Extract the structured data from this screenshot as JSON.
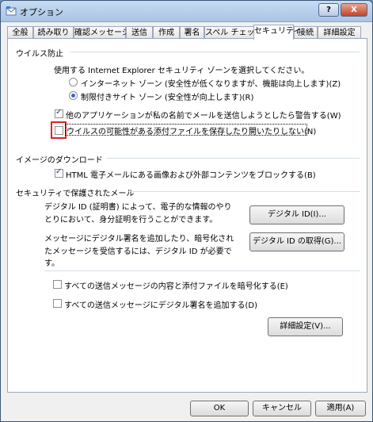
{
  "window": {
    "title": "オプション",
    "help_label": "?",
    "close_label": "X"
  },
  "tabs": [
    "全般",
    "読み取り",
    "確認メッセージ",
    "送信",
    "作成",
    "署名",
    "スペル チェック",
    "セキュリティ",
    "接続",
    "詳細設定"
  ],
  "virus": {
    "heading": "ウイルス防止",
    "zone_prompt": "使用する Internet Explorer セキュリティ ゾーンを選択してください。",
    "radio_internet": "インターネット ゾーン (安全性が低くなりますが、機能は向上します)(Z)",
    "radio_restricted": "制限付きサイト ゾーン (安全性が向上します)(R)",
    "radio_selected": "restricted",
    "warn_label": "他のアプリケーションが私の名前でメールを送信しようとしたら警告する(W)",
    "warn_checked": true,
    "attach_label": "ウイルスの可能性がある添付ファイルを保存したり開いたりしない(N)",
    "attach_checked": false
  },
  "images": {
    "heading": "イメージのダウンロード",
    "block_label": "HTML 電子メールにある画像および外部コンテンツをブロックする(B)",
    "block_checked": true
  },
  "secure_mail": {
    "heading": "セキュリティで保護されたメール",
    "digital_id_text1": "デジタル ID (証明書) によって、電子的な情報のやり",
    "digital_id_text2": "とりにおいて、身分証明を行うことができます。",
    "digital_id_button": "デジタル ID(I)...",
    "sign_text1": "メッセージにデジタル署名を追加したり、暗号化され",
    "sign_text2": "たメッセージを受信するには、デジタル ID が必要で",
    "sign_text3": "す。",
    "get_id_button": "デジタル ID の取得(G)...",
    "encrypt_label": "すべての送信メッセージの内容と添付ファイルを暗号化する(E)",
    "encrypt_checked": false,
    "sign_label": "すべての送信メッセージにデジタル署名を追加する(D)",
    "sign_checked": false,
    "advanced_button": "詳細設定(V)..."
  },
  "footer": {
    "ok": "OK",
    "cancel": "キャンセル",
    "apply": "適用(A)"
  },
  "colors": {
    "highlight": "#e0221e",
    "accent": "#2a6acb"
  }
}
